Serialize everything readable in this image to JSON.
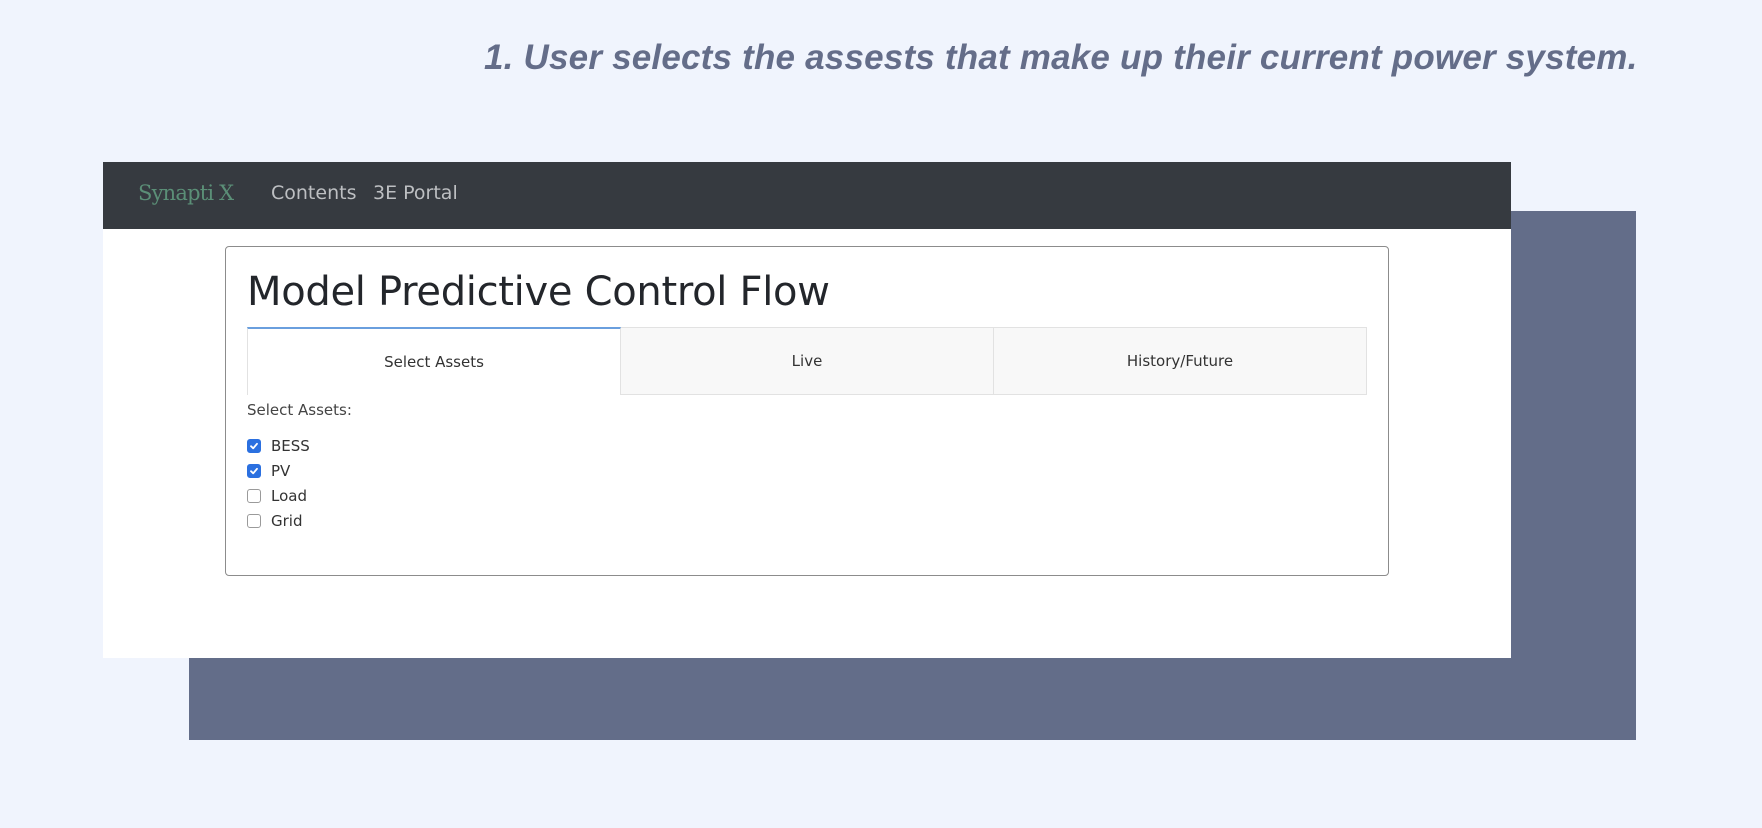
{
  "caption": "1. User selects the assests that make up their current power system.",
  "navbar": {
    "brand": "Synapti X",
    "links": [
      "Contents",
      "3E Portal"
    ]
  },
  "card": {
    "title": "Model Predictive Control Flow",
    "tabs": [
      {
        "label": "Select Assets",
        "active": true
      },
      {
        "label": "Live",
        "active": false
      },
      {
        "label": "History/Future",
        "active": false
      }
    ],
    "assets_label": "Select Assets:",
    "assets": [
      {
        "label": "BESS",
        "checked": true
      },
      {
        "label": "PV",
        "checked": true
      },
      {
        "label": "Load",
        "checked": false
      },
      {
        "label": "Grid",
        "checked": false
      }
    ]
  },
  "colors": {
    "page_background": "#f0f4fd",
    "caption_text": "#646d89",
    "shadow_panel": "#636d89",
    "navbar_background": "#363a40",
    "brand_text": "#5b8f77",
    "checkbox_checked": "#2b70e0",
    "active_tab_accent": "#6a9fde"
  }
}
